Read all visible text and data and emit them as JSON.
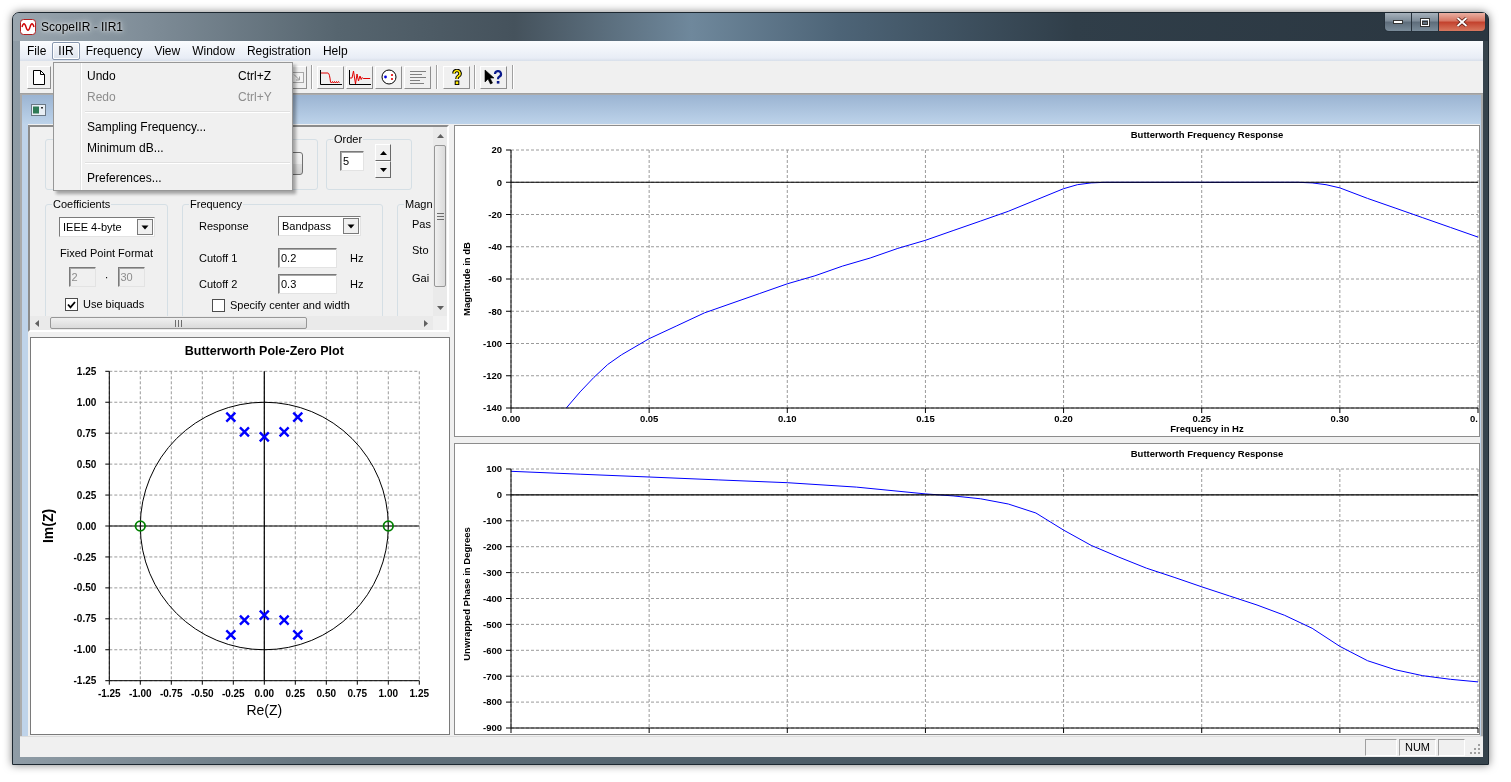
{
  "window": {
    "title": "ScopeIIR - IIR1"
  },
  "menu_bar": [
    {
      "label": "File",
      "selected": false
    },
    {
      "label": "IIR",
      "selected": true
    },
    {
      "label": "Frequency",
      "selected": false
    },
    {
      "label": "View",
      "selected": false
    },
    {
      "label": "Window",
      "selected": false
    },
    {
      "label": "Registration",
      "selected": false
    },
    {
      "label": "Help",
      "selected": false
    }
  ],
  "iir_menu": [
    {
      "kind": "item",
      "label": "Undo",
      "shortcut": "Ctrl+Z",
      "disabled": false
    },
    {
      "kind": "item",
      "label": "Redo",
      "shortcut": "Ctrl+Y",
      "disabled": true
    },
    {
      "kind": "separator"
    },
    {
      "kind": "item",
      "label": "Sampling Frequency...",
      "disabled": false
    },
    {
      "kind": "item",
      "label": "Minimum dB...",
      "disabled": false
    },
    {
      "kind": "separator"
    },
    {
      "kind": "item",
      "label": "Preferences...",
      "disabled": false
    }
  ],
  "settings_panel": {
    "order": {
      "label": "Order",
      "value": "5"
    },
    "coefficients": {
      "label": "Coefficients",
      "format": "IEEE 4-byte",
      "fixed_point_label": "Fixed Point Format",
      "fixed_point_integer": "2",
      "fixed_point_separator": "·",
      "fixed_point_fraction": "30",
      "fixed_point_disabled": true,
      "use_biquads": {
        "label": "Use biquads",
        "checked": true
      }
    },
    "frequency": {
      "label": "Frequency",
      "response_label": "Response",
      "response": "Bandpass",
      "cutoffs": [
        {
          "label": "Cutoff 1",
          "value": "0.2",
          "unit": "Hz"
        },
        {
          "label": "Cutoff 2",
          "value": "0.3",
          "unit": "Hz"
        }
      ],
      "center_and_width": {
        "label": "Specify center and width",
        "checked": false
      }
    },
    "magnitude": {
      "label": "Magn",
      "rows": [
        "Pas",
        "Sto",
        "Gai"
      ]
    }
  },
  "pole_zero_plot": {
    "chart_data": {
      "type": "scatter",
      "title": "Butterworth Pole-Zero Plot",
      "xlabel": "Re(Z)",
      "ylabel": "Im(Z)",
      "series": [
        {
          "color": "#0000ff",
          "x": [
            -0.27,
            -0.16,
            0,
            0.16,
            0.27,
            -0.27,
            -0.16,
            0,
            0.16,
            0.27
          ],
          "values": [
            0.88,
            0.76,
            0.72,
            0.76,
            0.88,
            -0.88,
            -0.76,
            -0.72,
            -0.76,
            -0.88
          ]
        },
        {
          "color": "#008000",
          "x": [
            -1,
            1
          ],
          "values": [
            0,
            0
          ]
        }
      ],
      "xlim": [
        -1.25,
        1.25
      ],
      "ylim": [
        -1.25,
        1.25
      ],
      "xticks": [
        {
          "value": -1.25,
          "label": "-1.25"
        },
        {
          "value": -1,
          "label": "-1.00"
        },
        {
          "value": -0.75,
          "label": "-0.75"
        },
        {
          "value": -0.5,
          "label": "-0.50"
        },
        {
          "value": -0.25,
          "label": "-0.25"
        },
        {
          "value": 0,
          "label": "0.00"
        },
        {
          "value": 0.25,
          "label": "0.25"
        },
        {
          "value": 0.5,
          "label": "0.50"
        },
        {
          "value": 0.75,
          "label": "0.75"
        },
        {
          "value": 1,
          "label": "1.00"
        },
        {
          "value": 1.25,
          "label": "1.25"
        }
      ],
      "yticks": [
        {
          "value": -1.25,
          "label": "-1.25"
        },
        {
          "value": -1,
          "label": "-1.00"
        },
        {
          "value": -0.75,
          "label": "-0.75"
        },
        {
          "value": -0.5,
          "label": "-0.50"
        },
        {
          "value": -0.25,
          "label": "-0.25"
        },
        {
          "value": 0,
          "label": "0.00"
        },
        {
          "value": 0.25,
          "label": "0.25"
        },
        {
          "value": 0.5,
          "label": "0.50"
        },
        {
          "value": 0.75,
          "label": "0.75"
        },
        {
          "value": 1,
          "label": "1.00"
        },
        {
          "value": 1.25,
          "label": "1.25"
        }
      ],
      "grid": true
    }
  },
  "magnitude_plot": {
    "chart_data": {
      "type": "line",
      "title": "Butterworth Frequency Response",
      "xlabel": "Frequency in Hz",
      "ylabel": "Magnitude in dB",
      "x": [
        0.02,
        0.025,
        0.03,
        0.035,
        0.04,
        0.05,
        0.06,
        0.07,
        0.08,
        0.09,
        0.1,
        0.11,
        0.12,
        0.13,
        0.14,
        0.15,
        0.16,
        0.17,
        0.18,
        0.19,
        0.2,
        0.205,
        0.21,
        0.215,
        0.22,
        0.25,
        0.28,
        0.285,
        0.29,
        0.295,
        0.3,
        0.31,
        0.32,
        0.33,
        0.34,
        0.35
      ],
      "series": [
        {
          "color": "#0000ff",
          "values": [
            -140,
            -130,
            -121,
            -113,
            -107,
            -97,
            -89,
            -81,
            -75,
            -69,
            -63,
            -58,
            -52,
            -47,
            -41,
            -36,
            -30,
            -24,
            -18,
            -11,
            -4,
            -1.5,
            -0.4,
            0,
            0,
            0,
            0,
            0,
            -0.4,
            -1.5,
            -3.5,
            -10,
            -16,
            -22,
            -28,
            -34
          ]
        }
      ],
      "xlim": [
        0,
        0.35
      ],
      "ylim": [
        -140,
        20
      ],
      "xticks": [
        {
          "value": 0,
          "label": "0.00"
        },
        {
          "value": 0.05,
          "label": "0.05"
        },
        {
          "value": 0.1,
          "label": "0.10"
        },
        {
          "value": 0.15,
          "label": "0.15"
        },
        {
          "value": 0.2,
          "label": "0.20"
        },
        {
          "value": 0.25,
          "label": "0.25"
        },
        {
          "value": 0.3,
          "label": "0.30"
        },
        {
          "value": 0.35,
          "label": "0."
        }
      ],
      "yticks": [
        20,
        0,
        -20,
        -40,
        -60,
        -80,
        -100,
        -120,
        -140
      ],
      "grid": true
    }
  },
  "phase_plot": {
    "chart_data": {
      "type": "line",
      "title": "Butterworth Frequency Response",
      "ylabel": "Unwrapped Phase in Degrees",
      "x": [
        0,
        0.025,
        0.05,
        0.075,
        0.1,
        0.125,
        0.15,
        0.16,
        0.17,
        0.18,
        0.19,
        0.2,
        0.21,
        0.22,
        0.23,
        0.24,
        0.25,
        0.26,
        0.27,
        0.28,
        0.29,
        0.3,
        0.31,
        0.32,
        0.33,
        0.34,
        0.35
      ],
      "series": [
        {
          "color": "#0000ff",
          "values": [
            91,
            80,
            69,
            58,
            47,
            30,
            4,
            -4,
            -15,
            -35,
            -70,
            -136,
            -195,
            -240,
            -283,
            -318,
            -355,
            -390,
            -425,
            -465,
            -515,
            -585,
            -640,
            -675,
            -698,
            -712,
            -722
          ]
        }
      ],
      "xlim": [
        0,
        0.35
      ],
      "ylim": [
        -900,
        100
      ],
      "yticks": [
        100,
        0,
        -100,
        -200,
        -300,
        -400,
        -500,
        -600,
        -700,
        -800,
        -900
      ],
      "grid": true
    }
  },
  "status_bar": {
    "indicator": "NUM"
  }
}
